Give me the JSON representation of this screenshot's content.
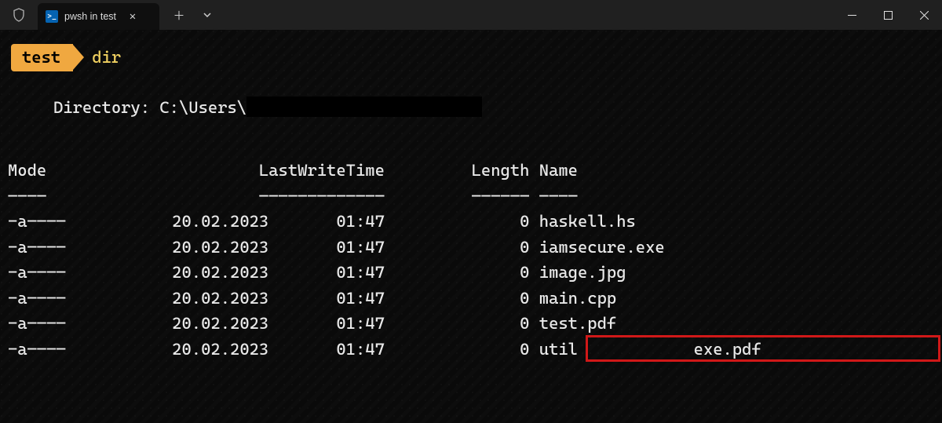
{
  "tab": {
    "title": "pwsh in test",
    "icon_glyph": ">_"
  },
  "prompt": {
    "badge": "test",
    "command": "dir"
  },
  "directory": {
    "label": "Directory: ",
    "path_prefix": "C:\\Users\\"
  },
  "headers": {
    "mode": "Mode",
    "lastwrite": "LastWriteTime",
    "length": "Length",
    "name": "Name"
  },
  "separators": {
    "mode": "————",
    "lastwrite": "—————————————",
    "length": "——————",
    "name": "————"
  },
  "rows": [
    {
      "mode": "-a————",
      "date": "20.02.2023",
      "time": "01:47",
      "length": "0",
      "name": "haskell.hs"
    },
    {
      "mode": "-a————",
      "date": "20.02.2023",
      "time": "01:47",
      "length": "0",
      "name": "iamsecure.exe"
    },
    {
      "mode": "-a————",
      "date": "20.02.2023",
      "time": "01:47",
      "length": "0",
      "name": "image.jpg"
    },
    {
      "mode": "-a————",
      "date": "20.02.2023",
      "time": "01:47",
      "length": "0",
      "name": "main.cpp"
    },
    {
      "mode": "-a————",
      "date": "20.02.2023",
      "time": "01:47",
      "length": "0",
      "name": "test.pdf"
    },
    {
      "mode": "-a————",
      "date": "20.02.2023",
      "time": "01:47",
      "length": "0",
      "name": "util            exe.pdf",
      "highlighted": true
    }
  ]
}
